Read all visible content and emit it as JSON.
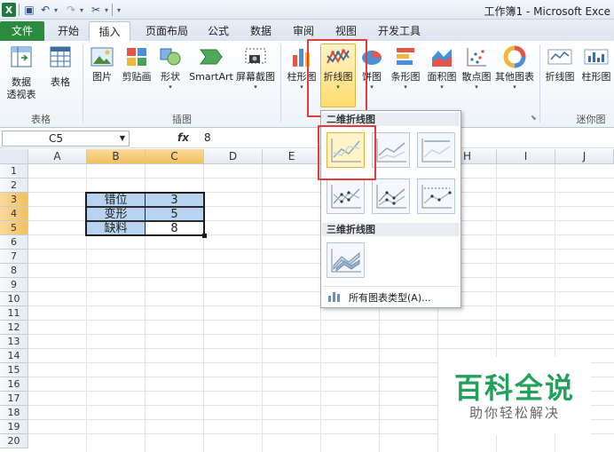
{
  "window": {
    "title": "工作簿1 - Microsoft Exce"
  },
  "tabs": [
    "文件",
    "开始",
    "插入",
    "页面布局",
    "公式",
    "数据",
    "审阅",
    "视图",
    "开发工具"
  ],
  "ribbon": {
    "tables": {
      "pivot": "数据\n透视表",
      "table": "表格",
      "group": "表格"
    },
    "illustrations": {
      "picture": "图片",
      "clipart": "剪贴画",
      "shapes": "形状",
      "smartart": "SmartArt",
      "screenshot": "屏幕截图",
      "group": "插图"
    },
    "charts": {
      "column": "柱形图",
      "line": "折线图",
      "pie": "饼图",
      "bar": "条形图",
      "area": "面积图",
      "scatter": "散点图",
      "other": "其他图表"
    },
    "sparklines": {
      "line": "折线图",
      "column": "柱形图",
      "group": "迷你图"
    }
  },
  "formula_bar": {
    "name_box": "C5",
    "fx": "fx",
    "value": "8"
  },
  "columns": [
    "A",
    "B",
    "C",
    "D",
    "E",
    "F",
    "G",
    "H",
    "I",
    "J"
  ],
  "rows": [
    "1",
    "2",
    "3",
    "4",
    "5",
    "6",
    "7",
    "8",
    "9",
    "10",
    "11",
    "12",
    "13",
    "14",
    "15",
    "16",
    "17",
    "18",
    "19",
    "20"
  ],
  "table": [
    {
      "label": "错位",
      "value": "3"
    },
    {
      "label": "变形",
      "value": "5"
    },
    {
      "label": "缺料",
      "value": "8"
    }
  ],
  "dropdown": {
    "section_2d": "二维折线图",
    "section_3d": "三维折线图",
    "all_types": "所有图表类型(A)..."
  },
  "watermark": {
    "title": "百科全说",
    "subtitle": "助你轻松解决"
  },
  "colors": {
    "file_tab": "#2a8a3e",
    "highlight": "#ffdc6e",
    "red_box": "#e53b3b",
    "selection": "#b8d3ef"
  }
}
